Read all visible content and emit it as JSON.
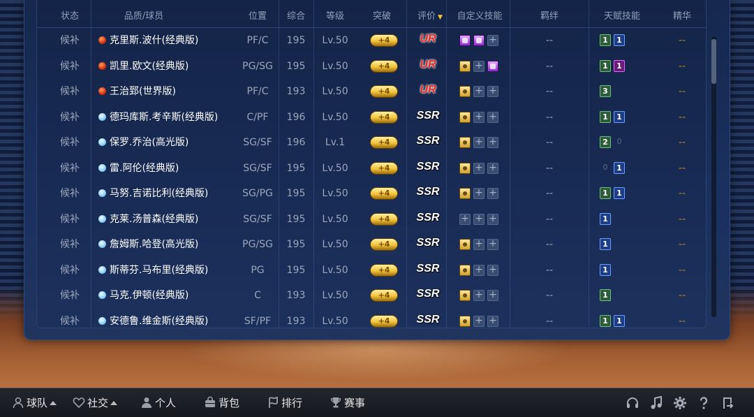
{
  "headers": {
    "status": "状态",
    "player": "品质/球员",
    "position": "位置",
    "overall": "综合",
    "level": "等级",
    "breakthrough": "突破",
    "rating": "评价",
    "custom_skills": "自定义技能",
    "bond": "羁绊",
    "talent_skills": "天赋技能",
    "essence": "精华"
  },
  "rows": [
    {
      "status": "候补",
      "quality": "red",
      "name": "克里斯.波什(经典版)",
      "pos": "PF/C",
      "ovr": "195",
      "lv": "Lv.50",
      "bt": "+4",
      "rating": "UR",
      "skills": [
        "purple",
        "purple",
        "plus"
      ],
      "bond": "--",
      "talents": [
        {
          "v": "1",
          "c": "green"
        },
        {
          "v": "1",
          "c": "blue"
        }
      ],
      "essence": "--"
    },
    {
      "status": "候补",
      "quality": "red",
      "name": "凯里.欧文(经典版)",
      "pos": "PG/SG",
      "ovr": "195",
      "lv": "Lv.50",
      "bt": "+4",
      "rating": "UR",
      "skills": [
        "gold",
        "plus",
        "purple"
      ],
      "bond": "--",
      "talents": [
        {
          "v": "1",
          "c": "green"
        },
        {
          "v": "1",
          "c": "purple"
        }
      ],
      "essence": "--"
    },
    {
      "status": "候补",
      "quality": "red",
      "name": "王治郅(世界版)",
      "pos": "PF/C",
      "ovr": "193",
      "lv": "Lv.50",
      "bt": "+4",
      "rating": "UR",
      "skills": [
        "gold",
        "plus",
        "plus"
      ],
      "bond": "--",
      "talents": [
        {
          "v": "3",
          "c": "green"
        }
      ],
      "essence": "--"
    },
    {
      "status": "候补",
      "quality": "blue",
      "name": "德玛库斯.考辛斯(经典版)",
      "pos": "C/PF",
      "ovr": "196",
      "lv": "Lv.50",
      "bt": "+4",
      "rating": "SSR",
      "skills": [
        "gold",
        "plus",
        "plus"
      ],
      "bond": "--",
      "talents": [
        {
          "v": "1",
          "c": "green"
        },
        {
          "v": "1",
          "c": "blue"
        }
      ],
      "essence": "--"
    },
    {
      "status": "候补",
      "quality": "blue",
      "name": "保罗.乔治(高光版)",
      "pos": "SG/SF",
      "ovr": "196",
      "lv": "Lv.1",
      "bt": "+4",
      "rating": "SSR",
      "skills": [
        "gold",
        "plus",
        "plus"
      ],
      "bond": "--",
      "talents": [
        {
          "v": "2",
          "c": "green"
        },
        {
          "v": "0",
          "c": "empty"
        }
      ],
      "essence": "--"
    },
    {
      "status": "候补",
      "quality": "blue",
      "name": "雷.阿伦(经典版)",
      "pos": "SG/SF",
      "ovr": "195",
      "lv": "Lv.50",
      "bt": "+4",
      "rating": "SSR",
      "skills": [
        "gold",
        "plus",
        "plus"
      ],
      "bond": "--",
      "talents": [
        {
          "v": "0",
          "c": "empty"
        },
        {
          "v": "1",
          "c": "blue"
        }
      ],
      "essence": "--"
    },
    {
      "status": "候补",
      "quality": "blue",
      "name": "马努.吉诺比利(经典版)",
      "pos": "SG/PG",
      "ovr": "195",
      "lv": "Lv.50",
      "bt": "+4",
      "rating": "SSR",
      "skills": [
        "gold",
        "plus",
        "plus"
      ],
      "bond": "--",
      "talents": [
        {
          "v": "1",
          "c": "green"
        },
        {
          "v": "1",
          "c": "blue"
        }
      ],
      "essence": "--"
    },
    {
      "status": "候补",
      "quality": "blue",
      "name": "克莱.汤普森(经典版)",
      "pos": "SG/SF",
      "ovr": "195",
      "lv": "Lv.50",
      "bt": "+4",
      "rating": "SSR",
      "skills": [
        "plus",
        "plus",
        "plus"
      ],
      "bond": "--",
      "talents": [
        {
          "v": "1",
          "c": "blue"
        }
      ],
      "essence": "--"
    },
    {
      "status": "候补",
      "quality": "blue",
      "name": "詹姆斯.哈登(高光版)",
      "pos": "PG/SG",
      "ovr": "195",
      "lv": "Lv.50",
      "bt": "+4",
      "rating": "SSR",
      "skills": [
        "gold",
        "plus",
        "plus"
      ],
      "bond": "--",
      "talents": [
        {
          "v": "1",
          "c": "blue"
        }
      ],
      "essence": "--"
    },
    {
      "status": "候补",
      "quality": "blue",
      "name": "斯蒂芬.马布里(经典版)",
      "pos": "PG",
      "ovr": "195",
      "lv": "Lv.50",
      "bt": "+4",
      "rating": "SSR",
      "skills": [
        "gold",
        "plus",
        "plus"
      ],
      "bond": "--",
      "talents": [
        {
          "v": "1",
          "c": "blue"
        }
      ],
      "essence": "--"
    },
    {
      "status": "候补",
      "quality": "blue",
      "name": "马克.伊顿(经典版)",
      "pos": "C",
      "ovr": "193",
      "lv": "Lv.50",
      "bt": "+4",
      "rating": "SSR",
      "skills": [
        "gold",
        "plus",
        "plus"
      ],
      "bond": "--",
      "talents": [
        {
          "v": "1",
          "c": "green"
        }
      ],
      "essence": "--"
    },
    {
      "status": "候补",
      "quality": "blue",
      "name": "安德鲁.维金斯(经典版)",
      "pos": "SF/PF",
      "ovr": "193",
      "lv": "Lv.50",
      "bt": "+4",
      "rating": "SSR",
      "skills": [
        "gold",
        "plus",
        "plus"
      ],
      "bond": "--",
      "talents": [
        {
          "v": "1",
          "c": "green"
        },
        {
          "v": "1",
          "c": "blue"
        }
      ],
      "essence": "--"
    }
  ],
  "nav": [
    {
      "key": "team",
      "label": "球队",
      "icon": "person-icon",
      "caret": true
    },
    {
      "key": "social",
      "label": "社交",
      "icon": "heart-icon",
      "caret": true
    },
    {
      "key": "personal",
      "label": "个人",
      "icon": "user-icon",
      "caret": false
    },
    {
      "key": "backpack",
      "label": "背包",
      "icon": "bag-icon",
      "caret": false
    },
    {
      "key": "ranking",
      "label": "排行",
      "icon": "flag-icon",
      "caret": false
    },
    {
      "key": "events",
      "label": "赛事",
      "icon": "trophy-icon",
      "caret": false
    }
  ],
  "right_icons": [
    "headset-icon",
    "music-icon",
    "gear-icon",
    "help-icon",
    "exit-icon"
  ],
  "colors": {
    "accent_gold": "#f2c43a",
    "ur_red": "#ef2b20",
    "panel_blue": "#1a3160"
  }
}
